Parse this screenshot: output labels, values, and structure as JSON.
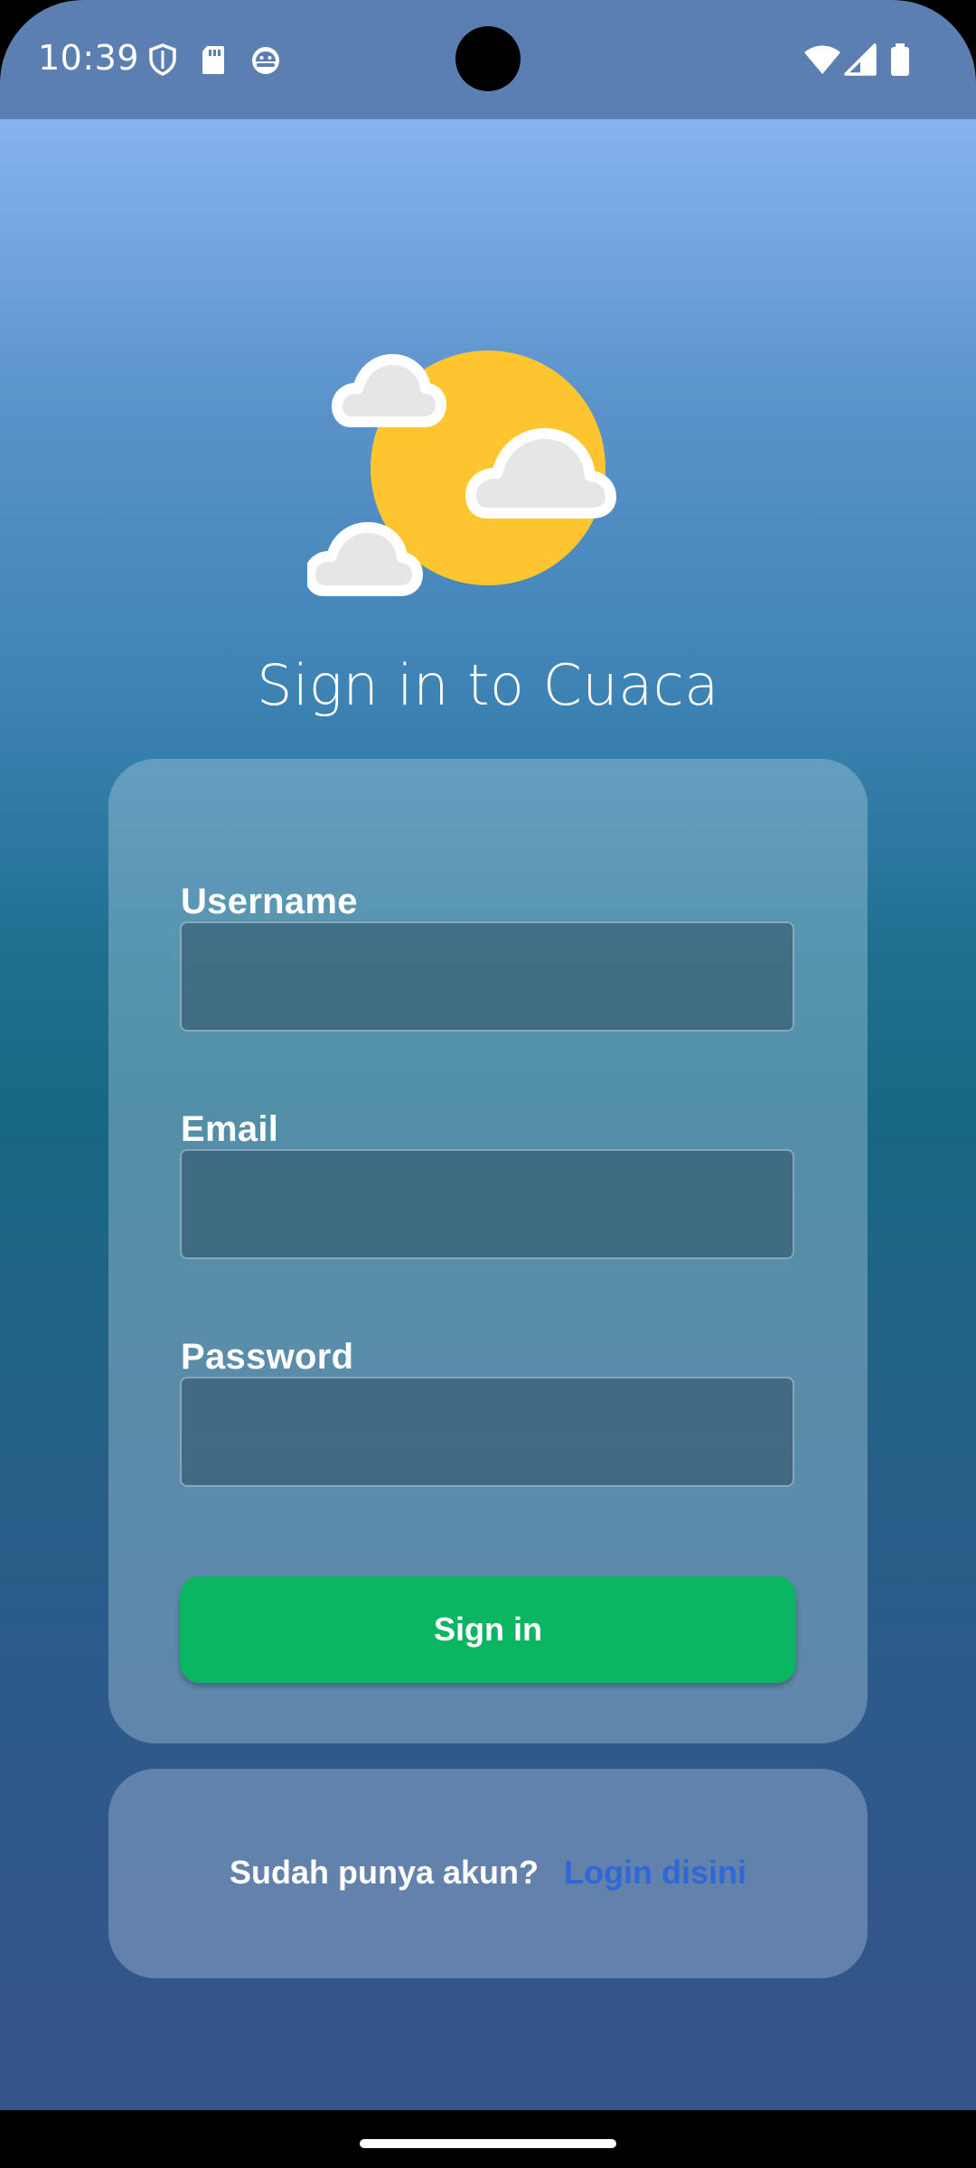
{
  "status_bar": {
    "time": "10:39",
    "icons_left": [
      "shield-icon",
      "sd-card-icon",
      "android-debug-icon"
    ],
    "icons_right": [
      "wifi-icon",
      "cell-signal-icon",
      "battery-icon"
    ]
  },
  "app": {
    "logo": "sun-clouds-weather-icon",
    "title": "Sign in to Cuaca"
  },
  "form": {
    "username_label": "Username",
    "username_value": "",
    "email_label": "Email",
    "email_value": "",
    "password_label": "Password",
    "password_value": "",
    "submit_label": "Sign in"
  },
  "footer": {
    "prompt": "Sudah punya akun?",
    "link_label": "Login disini"
  },
  "colors": {
    "primary_button": "#0bb663",
    "link": "#2f68d6",
    "sun": "#fdc631",
    "cloud": "#e6e6e6"
  }
}
